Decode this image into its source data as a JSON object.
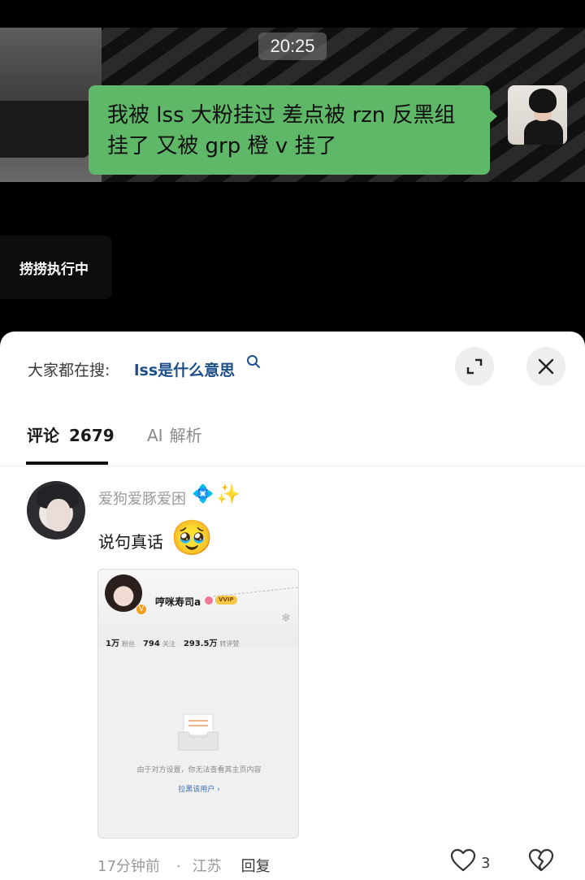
{
  "video": {
    "chat_time": "20:25",
    "chat_bubble_line1": "我被 lss 大粉挂过 差点被 rzn 反黑组",
    "chat_bubble_line2": "挂了 又被 grp 橙 v 挂了",
    "overlay_label": "捞捞执行中"
  },
  "search_bar": {
    "prefix": "大家都在搜:",
    "query": "lss是什么意思",
    "icon": "search-icon"
  },
  "buttons": {
    "expand_icon": "expand-icon",
    "close_icon": "close-icon"
  },
  "tabs": {
    "comment_label": "评论",
    "comment_count": "2679",
    "ai_label": "AI",
    "ai_sub_label": "解析"
  },
  "comment": {
    "username": "爱狗爱豚爱困",
    "badge_emoji": "💠",
    "sparkle_emoji": "✨",
    "text": "说句真话",
    "emoji": "🥹",
    "time": "17分钟前",
    "separator": "·",
    "location": "江苏",
    "reply_label": "回复",
    "like_count": "3",
    "image": {
      "profile_name": "哼咪寿司a",
      "vip_label": "VVIP",
      "v_badge": "V",
      "followers_value": "1万",
      "followers_label": "粉丝",
      "following_value": "794",
      "following_label": "关注",
      "likes_value": "293.5万",
      "likes_label": "转评赞",
      "private_message": "由于对方设置，你无法查看其主页内容",
      "block_link": "拉黑该用户 ›"
    }
  },
  "colors": {
    "bubble_green": "#5fb868",
    "link_blue": "#1c4f8a",
    "sheet_bg": "#ffffff"
  }
}
